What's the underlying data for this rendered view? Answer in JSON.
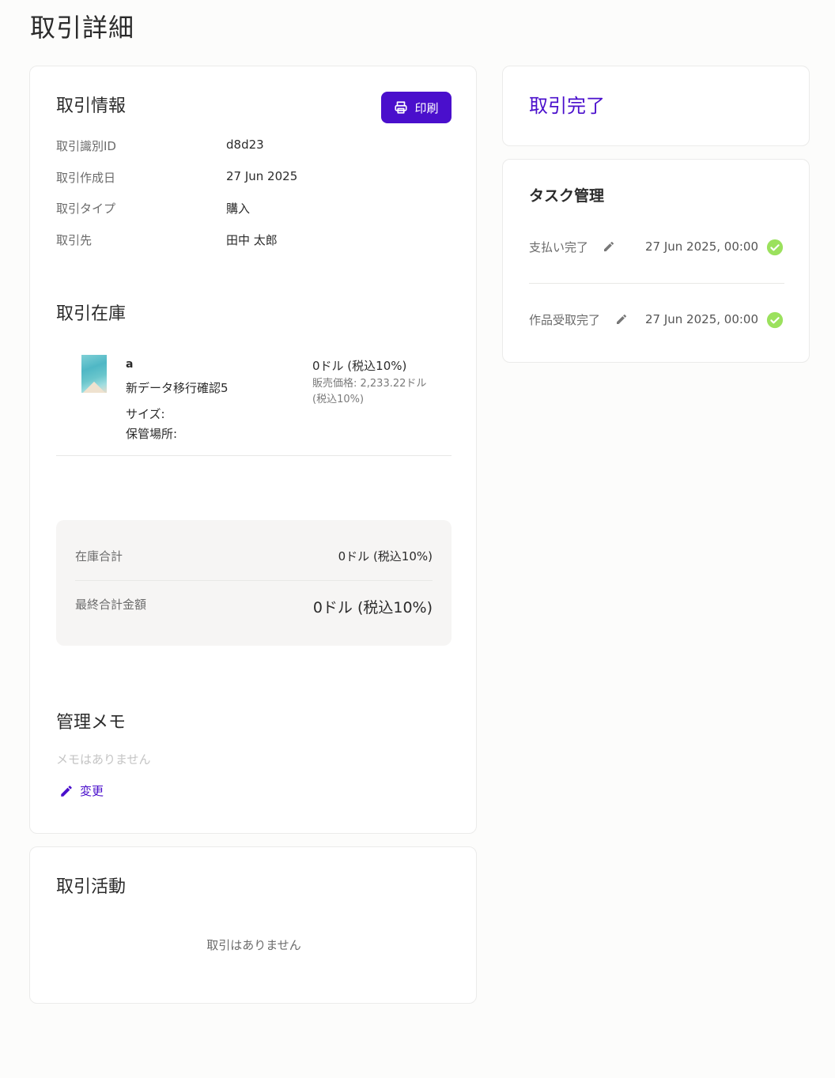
{
  "page": {
    "title": "取引詳細"
  },
  "transaction_info": {
    "title": "取引情報",
    "print_label": "印刷",
    "rows": [
      {
        "label": "取引識別ID",
        "value": "d8d23"
      },
      {
        "label": "取引作成日",
        "value": "27 Jun 2025"
      },
      {
        "label": "取引タイプ",
        "value": "購入"
      },
      {
        "label": "取引先",
        "value": "田中 太郎"
      }
    ]
  },
  "inventory": {
    "title": "取引在庫",
    "item": {
      "code": "a",
      "name": "新データ移行確認5",
      "size_label": "サイズ:",
      "location_label": "保管場所:",
      "price": "0ドル (税込10%)",
      "sale_price_line1": "販売価格: 2,233.22ドル",
      "sale_price_line2": "(税込10%)"
    }
  },
  "totals": {
    "inventory_label": "在庫合計",
    "inventory_value": "0ドル (税込10%)",
    "final_label": "最終合計金額",
    "final_value": "0ドル (税込10%)"
  },
  "memo": {
    "title": "管理メモ",
    "empty_text": "メモはありません",
    "change_label": "変更"
  },
  "activity": {
    "title": "取引活動",
    "empty_text": "取引はありません"
  },
  "status": {
    "text": "取引完了"
  },
  "tasks": {
    "title": "タスク管理",
    "items": [
      {
        "label": "支払い完了",
        "date": "27 Jun 2025, 00:00"
      },
      {
        "label": "作品受取完了",
        "date": "27 Jun 2025, 00:00"
      }
    ]
  },
  "colors": {
    "accent": "#4a0fcc",
    "check": "#9be15d",
    "background": "#fcfcfb"
  }
}
